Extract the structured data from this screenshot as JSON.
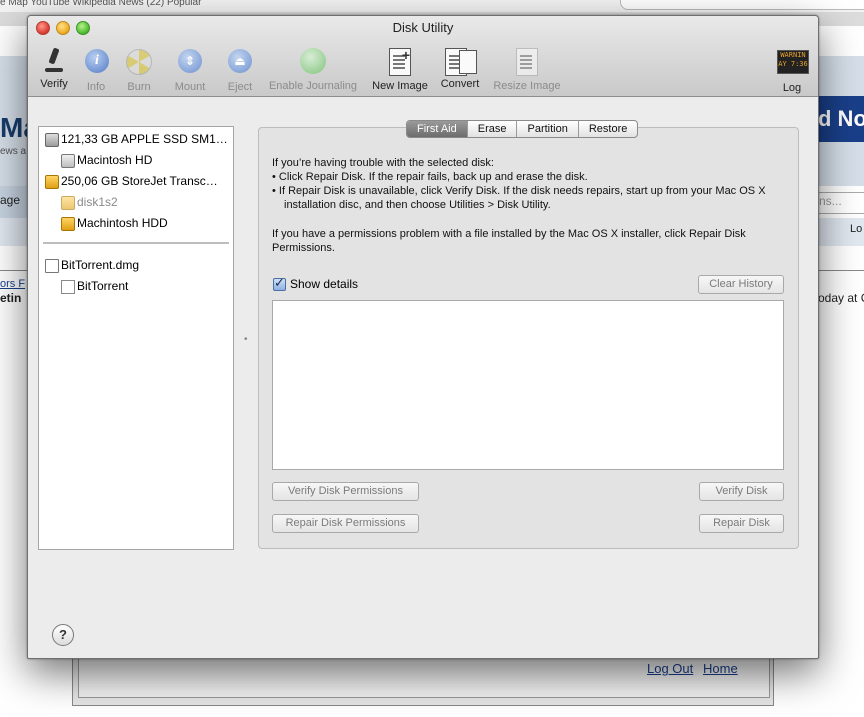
{
  "background": {
    "tab_text": "e Map    YouTube    Wikipedia    News (22)    Popular",
    "left_logo": "Ma",
    "left_news": "ews a",
    "left_age": "age",
    "left_ors": "ors F",
    "left_etin": "etin",
    "right_banner": "d No",
    "right_search_placeholder": "ns...",
    "right_lo": "Lo",
    "right_today": "oday at C",
    "logout": "Log Out",
    "home": "Home"
  },
  "window": {
    "title": "Disk Utility"
  },
  "toolbar": {
    "verify": "Verify",
    "info": "Info",
    "burn": "Burn",
    "mount": "Mount",
    "eject": "Eject",
    "enable_journaling": "Enable Journaling",
    "new_image": "New Image",
    "convert": "Convert",
    "resize_image": "Resize Image",
    "log": "Log",
    "log_screen": "WARNIN\nAY 7:36"
  },
  "sidebar": {
    "disks": [
      {
        "label": "121,33 GB APPLE SSD SM1…",
        "kind": "hard-disk"
      },
      {
        "label": "Macintosh HD",
        "kind": "volume"
      },
      {
        "label": "250,06 GB StoreJet Transc…",
        "kind": "external-disk"
      },
      {
        "label": "disk1s2",
        "kind": "external-volume-unmounted"
      },
      {
        "label": "Machintosh HDD",
        "kind": "external-volume"
      }
    ],
    "images": [
      {
        "label": "BitTorrent.dmg",
        "kind": "disk-image"
      },
      {
        "label": "BitTorrent",
        "kind": "image-volume"
      }
    ]
  },
  "tabs": [
    "First Aid",
    "Erase",
    "Partition",
    "Restore"
  ],
  "first_aid": {
    "intro_title": "If you’re having trouble with the selected disk:",
    "bullet_1": "• Click Repair Disk. If the repair fails, back up and erase the disk.",
    "bullet_2": "• If Repair Disk is unavailable, click Verify Disk. If the disk needs repairs, start up from your Mac OS X installation disc, and then choose Utilities > Disk Utility.",
    "permissions_text": "If you have a permissions problem with a file installed by the Mac OS X installer, click Repair Disk Permissions.",
    "show_details": "Show details",
    "show_details_checked": true,
    "clear_history": "Clear History",
    "verify_permissions": "Verify Disk Permissions",
    "verify_disk": "Verify Disk",
    "repair_permissions": "Repair Disk Permissions",
    "repair_disk": "Repair Disk"
  },
  "help": "?"
}
